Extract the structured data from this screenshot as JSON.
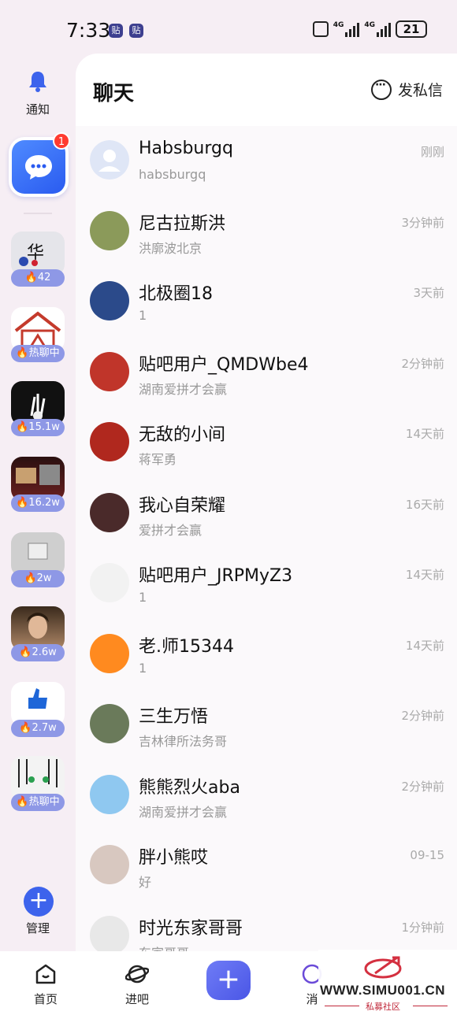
{
  "status_bar": {
    "time": "7:33",
    "badges": [
      "贴",
      "贴"
    ],
    "net_labels": [
      "4G",
      "4G"
    ],
    "battery": "21"
  },
  "rail": {
    "notify_label": "通知",
    "unread_count": "1",
    "forums": [
      {
        "label": "42",
        "color": "#e5e5ea"
      },
      {
        "label": "热聊中",
        "color": "#c43a2c"
      },
      {
        "label": "15.1w",
        "color": "#111111"
      },
      {
        "label": "16.2w",
        "color": "#3a1414"
      },
      {
        "label": "2w",
        "color": "#c8c8c8"
      },
      {
        "label": "2.6w",
        "color": "#7a5a3c"
      },
      {
        "label": "2.7w",
        "color": "#ffffff"
      },
      {
        "label": "热聊中",
        "color": "#f3f3f3"
      }
    ],
    "manage_label": "管理"
  },
  "header": {
    "title": "聊天",
    "dm_label": "发私信"
  },
  "chats": [
    {
      "name": "Habsburgq",
      "sub": "habsburgq",
      "time": "刚刚",
      "avatar": "default"
    },
    {
      "name": "尼古拉斯洪",
      "sub": "洪廓波北京",
      "time": "3分钟前",
      "avatar": "#8b9a5a"
    },
    {
      "name": "北极圈18",
      "sub": "1",
      "time": "3天前",
      "avatar": "#2b4a8a"
    },
    {
      "name": "贴吧用户_QMDWbe4",
      "sub": "湖南爱拼才会赢",
      "time": "2分钟前",
      "avatar": "#c0352a"
    },
    {
      "name": "无敌的小间",
      "sub": "蒋军勇",
      "time": "14天前",
      "avatar": "#b0281e"
    },
    {
      "name": "我心自荣耀",
      "sub": "爱拼才会赢",
      "time": "16天前",
      "avatar": "#4a2a2a"
    },
    {
      "name": "贴吧用户_JRPMyZ3",
      "sub": "1",
      "time": "14天前",
      "avatar": "#f2f2f2"
    },
    {
      "name": "老.师15344",
      "sub": "1",
      "time": "14天前",
      "avatar": "#ff8a1f"
    },
    {
      "name": "三生万悟",
      "sub": "吉林律所法务哥",
      "time": "2分钟前",
      "avatar": "#6a7a5a"
    },
    {
      "name": "熊熊烈火aba",
      "sub": "湖南爱拼才会赢",
      "time": "2分钟前",
      "avatar": "#8fc8f0"
    },
    {
      "name": "胖小熊哎",
      "sub": "好",
      "time": "09-15",
      "avatar": "#d8c8c0"
    },
    {
      "name": "时光东家哥哥",
      "sub": "东家哥哥",
      "time": "1分钟前",
      "avatar": "#e8e8e8"
    }
  ],
  "tabbar": {
    "home": "首页",
    "explore": "进吧",
    "messages": "消"
  },
  "watermark": {
    "url": "WWW.SIMU001.CN",
    "sub": "私募社区"
  },
  "colors": {
    "accent": "#3d63ec",
    "pill": "#8e98e6",
    "unread": "#ff3b30"
  }
}
